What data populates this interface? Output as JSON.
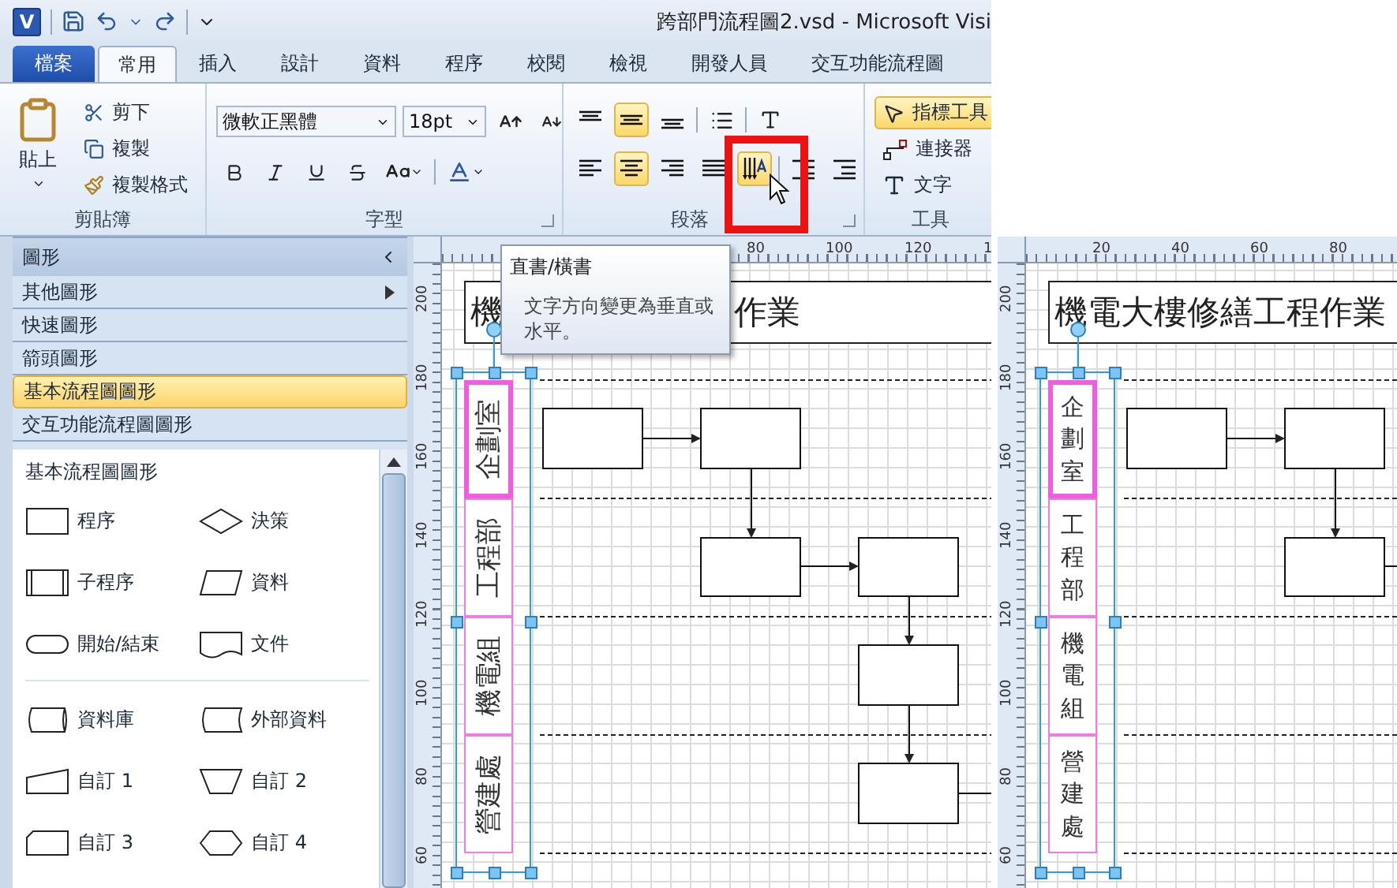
{
  "window": {
    "app_icon": "V",
    "title": "跨部門流程圖2.vsd  -  Microsoft Visi"
  },
  "tabs": [
    {
      "label": "檔案",
      "kind": "file",
      "selected": false
    },
    {
      "label": "常用",
      "kind": "tab",
      "selected": true
    },
    {
      "label": "插入",
      "kind": "tab",
      "selected": false
    },
    {
      "label": "設計",
      "kind": "tab",
      "selected": false
    },
    {
      "label": "資料",
      "kind": "tab",
      "selected": false
    },
    {
      "label": "程序",
      "kind": "tab",
      "selected": false
    },
    {
      "label": "校閱",
      "kind": "tab",
      "selected": false
    },
    {
      "label": "檢視",
      "kind": "tab",
      "selected": false
    },
    {
      "label": "開發人員",
      "kind": "tab",
      "selected": false
    },
    {
      "label": "交互功能流程圖",
      "kind": "tab",
      "selected": false
    }
  ],
  "ribbon": {
    "clipboard": {
      "label": "剪貼簿",
      "paste": "貼上",
      "items": [
        "剪下",
        "複製",
        "複製格式"
      ]
    },
    "font": {
      "label": "字型",
      "font_name": "微軟正黑體",
      "font_size": "18pt"
    },
    "paragraph": {
      "label": "段落",
      "vertical_align": [
        {
          "selected": false
        },
        {
          "selected": true
        },
        {
          "selected": false
        }
      ],
      "horizontal_align": [
        {
          "selected": false
        },
        {
          "selected": true
        },
        {
          "selected": false
        },
        {
          "selected": false
        }
      ],
      "text_direction": {
        "highlighted": true,
        "callout": true
      }
    },
    "tools": {
      "label": "工具",
      "items": [
        {
          "label": "指標工具",
          "kind": "pointer",
          "selected": true
        },
        {
          "label": "連接器",
          "kind": "connector",
          "selected": false
        },
        {
          "label": "文字",
          "kind": "text",
          "selected": false
        }
      ]
    }
  },
  "shapes_panel": {
    "title": "圖形",
    "stencils": [
      {
        "label": "其他圖形",
        "kind": "menu",
        "selected": false
      },
      {
        "label": "快速圖形",
        "kind": "stencil",
        "selected": false
      },
      {
        "label": "箭頭圖形",
        "kind": "stencil",
        "selected": false
      },
      {
        "label": "基本流程圖圖形",
        "kind": "stencil",
        "selected": true
      },
      {
        "label": "交互功能流程圖圖形",
        "kind": "stencil",
        "selected": false
      }
    ],
    "stencil_title": "基本流程圖圖形",
    "shape_groups": [
      [
        {
          "label": "程序",
          "kind": "process"
        },
        {
          "label": "決策",
          "kind": "decision"
        },
        {
          "label": "子程序",
          "kind": "subprocess"
        },
        {
          "label": "資料",
          "kind": "data"
        },
        {
          "label": "開始/結束",
          "kind": "terminator"
        },
        {
          "label": "文件",
          "kind": "document"
        }
      ],
      [
        {
          "label": "資料庫",
          "kind": "database"
        },
        {
          "label": "外部資料",
          "kind": "external"
        },
        {
          "label": "自訂 1",
          "kind": "custom1"
        },
        {
          "label": "自訂 2",
          "kind": "custom2"
        },
        {
          "label": "自訂 3",
          "kind": "custom3"
        },
        {
          "label": "自訂 4",
          "kind": "custom4"
        }
      ]
    ]
  },
  "canvases": [
    {
      "horizontal_ruler": [
        "80",
        "100",
        "120",
        "1"
      ],
      "vertical_ruler": [
        "200",
        "180",
        "160",
        "140",
        "120",
        "100",
        "80",
        "60"
      ],
      "title_parts": [
        "機",
        "作業"
      ],
      "kind": "rotated",
      "lanes": [
        {
          "label": "企劃室",
          "selected": true
        },
        {
          "label": "工程部",
          "selected": false
        },
        {
          "label": "機電組",
          "selected": false
        },
        {
          "label": "營建處",
          "selected": false
        }
      ],
      "tooltip": {
        "title": "直書/橫書",
        "body": "文字方向變更為垂直或水平。"
      }
    },
    {
      "horizontal_ruler": [
        "20",
        "40",
        "60",
        "80"
      ],
      "vertical_ruler": [
        "200",
        "180",
        "160",
        "140",
        "120",
        "100",
        "80",
        "60"
      ],
      "title_parts": [
        "機電大樓修繕工程作業"
      ],
      "kind": "stacked",
      "lanes": [
        {
          "label": "企劃室",
          "selected": true
        },
        {
          "label": "工程部",
          "selected": false
        },
        {
          "label": "機電組",
          "selected": false
        },
        {
          "label": "營建處",
          "selected": false
        }
      ]
    }
  ]
}
